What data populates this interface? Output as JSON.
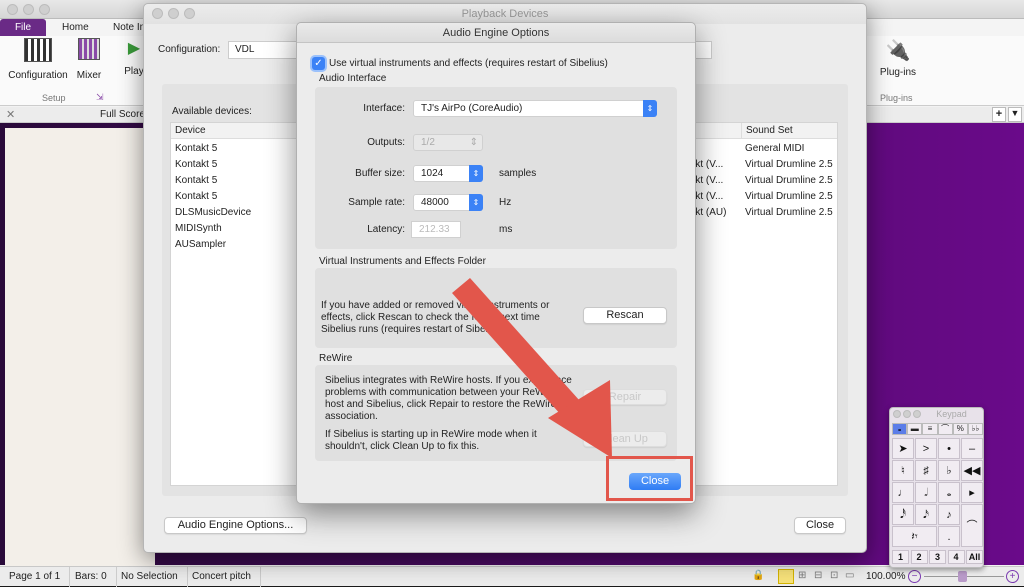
{
  "app": {
    "ribbon_tabs": [
      "File",
      "Home",
      "Note In"
    ],
    "ribbon_buttons": {
      "configuration": "Configuration",
      "mixer": "Mixer",
      "play": "Play",
      "plugins": "Plug-ins"
    },
    "ribbon_groups": {
      "setup": "Setup",
      "plugins": "Plug-ins"
    },
    "score_tab": "Full Score",
    "icons": [
      "piano-icon",
      "mixer-icon",
      "play-icon",
      "plug-icon",
      "save-icon",
      "undo-icon",
      "redo-icon",
      "help-icon",
      "close-icon",
      "plus-icon",
      "dropdown-icon"
    ]
  },
  "playback_window": {
    "title": "Playback Devices",
    "configuration_label": "Configuration:",
    "configuration_value": "VDL",
    "available_label": "Available devices:",
    "columns": [
      "Device",
      "Sound Set"
    ],
    "devices": [
      {
        "device": "Kontakt 5",
        "engine": "",
        "sound_set": "General MIDI"
      },
      {
        "device": "Kontakt 5",
        "engine": "takt (V...",
        "sound_set": "Virtual Drumline 2.5"
      },
      {
        "device": "Kontakt 5",
        "engine": "takt (V...",
        "sound_set": "Virtual Drumline 2.5"
      },
      {
        "device": "Kontakt 5",
        "engine": "takt (V...",
        "sound_set": "Virtual Drumline 2.5"
      },
      {
        "device": "DLSMusicDevice",
        "engine": "takt (AU)",
        "sound_set": "Virtual Drumline 2.5"
      },
      {
        "device": "MIDISynth",
        "engine": "",
        "sound_set": ""
      },
      {
        "device": "AUSampler",
        "engine": "",
        "sound_set": ""
      }
    ],
    "audio_engine_button": "Audio Engine Options...",
    "close_button": "Close"
  },
  "audio_engine_dialog": {
    "title": "Audio Engine Options",
    "use_vi_checkbox": {
      "label": "Use virtual instruments and effects (requires restart of Sibelius)",
      "checked": true
    },
    "audio_interface": {
      "section_title": "Audio Interface",
      "interface_label": "Interface:",
      "interface_value": "TJ's AirPo (CoreAudio)",
      "outputs_label": "Outputs:",
      "outputs_value": "1/2",
      "buffer_label": "Buffer size:",
      "buffer_value": "1024",
      "buffer_unit": "samples",
      "rate_label": "Sample rate:",
      "rate_value": "48000",
      "rate_unit": "Hz",
      "latency_label": "Latency:",
      "latency_value": "212.33",
      "latency_unit": "ms"
    },
    "vi_folder": {
      "section_title": "Virtual Instruments and Effects Folder",
      "text": "If you have added or removed virtual instruments or effects, click Rescan to check the folder next time Sibelius runs (requires restart of Sibelius).",
      "rescan_button": "Rescan"
    },
    "rewire": {
      "section_title": "ReWire",
      "text1": "Sibelius integrates with ReWire hosts. If you experience problems with communication between your ReWire host and Sibelius, click Repair to restore the ReWire association.",
      "repair_button": "Repair",
      "text2": "If Sibelius is starting up in ReWire mode when it shouldn't, click Clean Up to fix this.",
      "cleanup_button": "Clean Up"
    },
    "close_button": "Close"
  },
  "annotation": {
    "arrow_color": "#e2564b",
    "highlight_target": "Close"
  },
  "keypad": {
    "title": "Keypad",
    "tabs": [
      "𝅝",
      "▬",
      "≡",
      "⌒",
      "%",
      "♭♭"
    ],
    "keys": [
      "➤",
      ">",
      "•",
      "–",
      "♮",
      "♯",
      "♭",
      "◀◀",
      "♩",
      "𝅗𝅥",
      "𝅝",
      "▸",
      "𝅘𝅥𝅰",
      "𝅘𝅥𝅯",
      "♪",
      "⌒",
      "𝄽𝄾",
      "."
    ],
    "layouts": [
      "1",
      "2",
      "3",
      "4",
      "All"
    ]
  },
  "status_bar": {
    "page": "Page 1 of 1",
    "bars": "Bars: 0",
    "selection": "No Selection",
    "pitch": "Concert pitch",
    "zoom": "100.00%"
  }
}
